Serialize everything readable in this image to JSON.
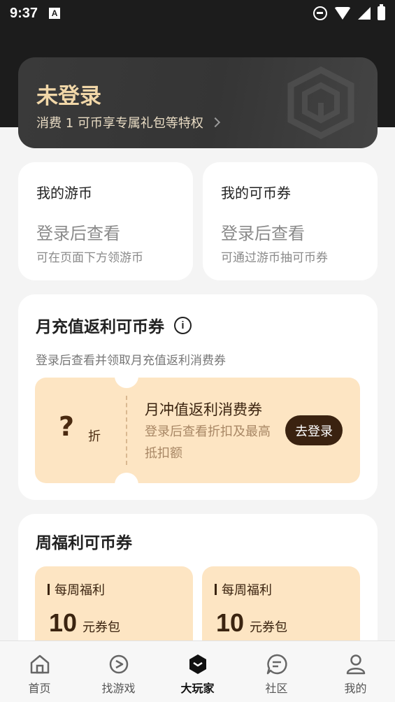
{
  "status_bar": {
    "time": "9:37",
    "notification_badge": "A"
  },
  "login_banner": {
    "title": "未登录",
    "subtitle": "消费 1 可币享专属礼包等特权"
  },
  "coin_cards": [
    {
      "title": "我的游币",
      "value": "登录后查看",
      "desc": "可在页面下方领游币"
    },
    {
      "title": "我的可币券",
      "value": "登录后查看",
      "desc": "可通过游币抽可币券"
    }
  ],
  "monthly_rebate": {
    "title": "月充值返利可币券",
    "info_glyph": "i",
    "desc": "登录后查看并领取月充值返利消费券",
    "coupon": {
      "discount": "?",
      "discount_unit": "折",
      "name": "月冲值返利消费券",
      "desc": "登录后查看折扣及最高抵扣额",
      "button": "去登录"
    }
  },
  "weekly_welfare": {
    "title": "周福利可币券",
    "packs": [
      {
        "label": "每周福利",
        "amount": "10",
        "unit": "元券包"
      },
      {
        "label": "每周福利",
        "amount": "10",
        "unit": "元券包"
      }
    ]
  },
  "bottom_nav": {
    "active": "大玩家",
    "items": [
      {
        "label": "首页",
        "icon": "home-icon"
      },
      {
        "label": "找游戏",
        "icon": "game-icon"
      },
      {
        "label": "大玩家",
        "icon": "player-icon"
      },
      {
        "label": "社区",
        "icon": "community-icon"
      },
      {
        "label": "我的",
        "icon": "profile-icon"
      }
    ]
  },
  "colors": {
    "banner_gold": "#f1d7a8",
    "coupon_bg": "#fde5c3",
    "coupon_button": "#3a2210",
    "header_bg": "#1c1c1c"
  }
}
